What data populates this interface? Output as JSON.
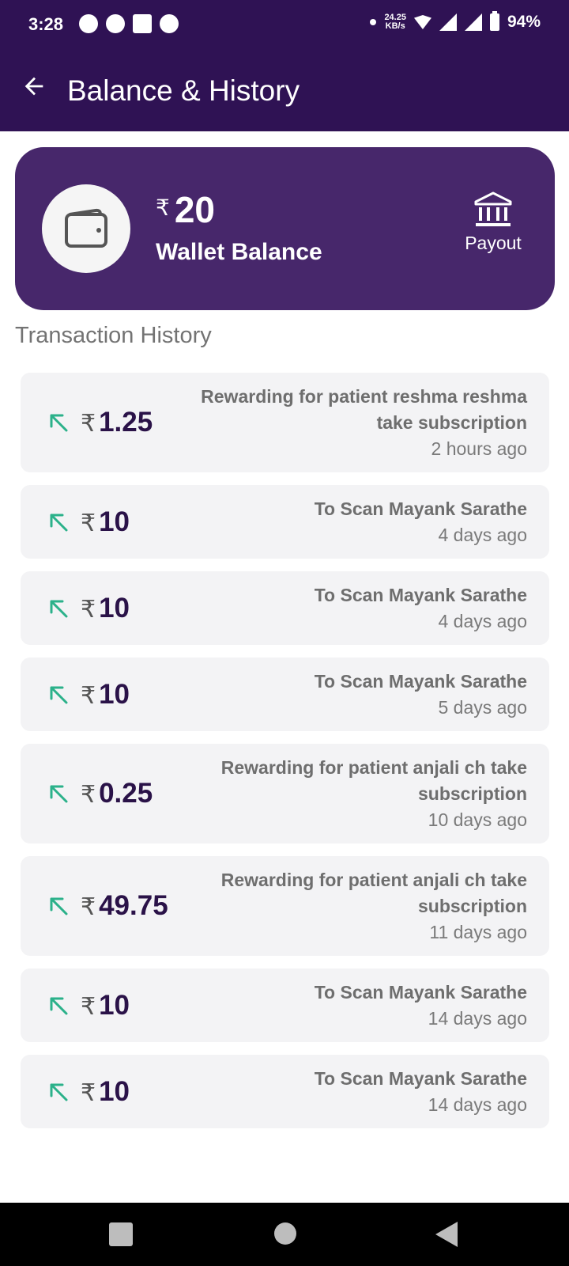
{
  "status_bar": {
    "time": "3:28",
    "net_speed_value": "24.25",
    "net_speed_unit": "KB/s",
    "battery": "94%"
  },
  "app_bar": {
    "title": "Balance & History"
  },
  "wallet": {
    "currency_symbol": "₹",
    "amount": "20",
    "label": "Wallet Balance",
    "payout_label": "Payout"
  },
  "history": {
    "title": "Transaction History",
    "currency_symbol": "₹",
    "items": [
      {
        "amount": "1.25",
        "desc_line1": "Rewarding for patient reshma reshma",
        "desc_line2": "take subscription",
        "time": "2 hours ago"
      },
      {
        "amount": "10",
        "desc_line1": "To Scan Mayank Sarathe",
        "desc_line2": "",
        "time": "4 days ago"
      },
      {
        "amount": "10",
        "desc_line1": "To Scan Mayank Sarathe",
        "desc_line2": "",
        "time": "4 days ago"
      },
      {
        "amount": "10",
        "desc_line1": "To Scan Mayank Sarathe",
        "desc_line2": "",
        "time": "5 days ago"
      },
      {
        "amount": "0.25",
        "desc_line1": "Rewarding for patient anjali ch take",
        "desc_line2": "subscription",
        "time": "10 days ago"
      },
      {
        "amount": "49.75",
        "desc_line1": "Rewarding for patient anjali ch take",
        "desc_line2": "subscription",
        "time": "11 days ago"
      },
      {
        "amount": "10",
        "desc_line1": "To Scan Mayank Sarathe",
        "desc_line2": "",
        "time": "14 days ago"
      },
      {
        "amount": "10",
        "desc_line1": "To Scan Mayank Sarathe",
        "desc_line2": "",
        "time": "14 days ago"
      }
    ]
  },
  "colors": {
    "header": "#2f1254",
    "card": "#47276b",
    "arrow": "#2bb18a",
    "amount": "#2a1248"
  }
}
